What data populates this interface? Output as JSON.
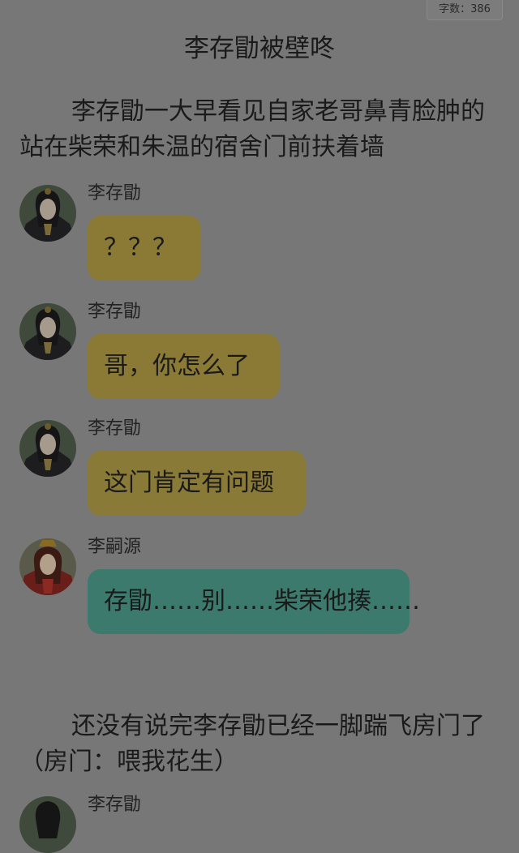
{
  "header": {
    "word_count": "字数：386"
  },
  "title": "李存勖被壁咚",
  "paragraphs": {
    "intro": "李存勖一大早看见自家老哥鼻青脸肿的站在柴荣和朱温的宿舍门前扶着墙",
    "outro": "还没有说完李存勖已经一脚踹飞房门了（房门：喂我花生）"
  },
  "messages": [
    {
      "sender": "李存勖",
      "text": "？？？"
    },
    {
      "sender": "李存勖",
      "text": "哥，你怎么了"
    },
    {
      "sender": "李存勖",
      "text": "这门肯定有问题"
    },
    {
      "sender": "李嗣源",
      "text": "存勖……别……柴荣他揍……"
    }
  ],
  "partial_next": {
    "sender": "李存勖"
  },
  "colors": {
    "background": "#777777",
    "bubble_lcunxu": "#8a7a36",
    "bubble_lsiyuan": "#3d7a6e"
  },
  "icons": {
    "avatar_lcunxu": "avatar-lcunxu-icon",
    "avatar_lsiyuan": "avatar-lsiyuan-icon"
  }
}
